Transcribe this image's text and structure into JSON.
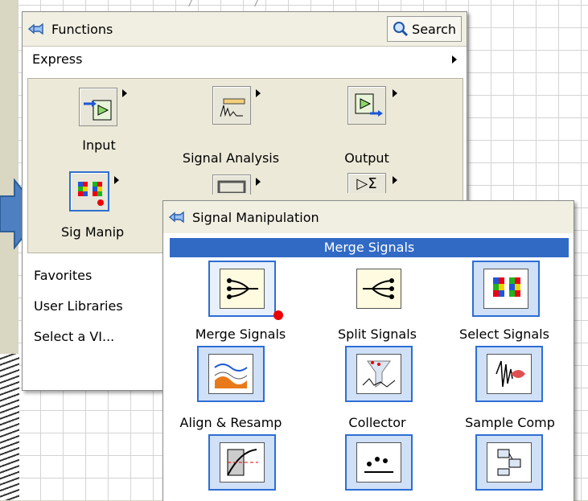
{
  "functions_palette": {
    "title": "Functions",
    "search_label": "Search",
    "category": "Express",
    "icons": [
      {
        "label": "Input",
        "icon": "input-icon"
      },
      {
        "label": "Signal Analysis",
        "icon": "signal-analysis-icon"
      },
      {
        "label": "Output",
        "icon": "output-icon"
      },
      {
        "label": "Sig Manip",
        "icon": "sig-manip-icon"
      },
      {
        "label": "",
        "icon": "exec-control-icon"
      },
      {
        "label": "",
        "icon": "arith-compare-icon"
      }
    ],
    "menu_items": [
      "Favorites",
      "User Libraries",
      "Select a VI..."
    ]
  },
  "sigmanip_palette": {
    "title": "Signal Manipulation",
    "highlight": "Merge Signals",
    "icons": [
      {
        "label": "Merge Signals",
        "icon": "merge-signals-icon"
      },
      {
        "label": "Split Signals",
        "icon": "split-signals-icon"
      },
      {
        "label": "Select Signals",
        "icon": "select-signals-icon"
      },
      {
        "label": "Align & Resamp",
        "icon": "align-resample-icon"
      },
      {
        "label": "Collector",
        "icon": "collector-icon"
      },
      {
        "label": "Sample Comp",
        "icon": "sample-compression-icon"
      },
      {
        "label": "",
        "icon": "relay-icon"
      },
      {
        "label": "",
        "icon": "trigger-gate-icon"
      },
      {
        "label": "",
        "icon": "convert-icon"
      }
    ]
  },
  "colors": {
    "selection": "#2e6fd0",
    "header": "#f1efe2",
    "arrow": "#4d7fc1",
    "marker": "#e00000"
  }
}
